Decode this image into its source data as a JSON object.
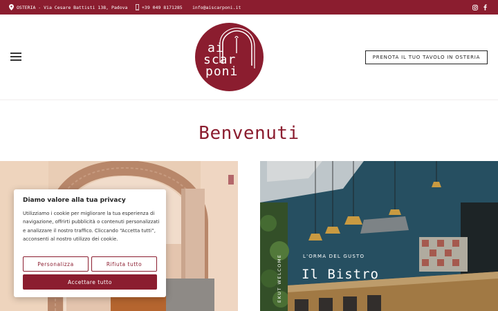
{
  "topbar": {
    "address": "OSTERIA - Via Cesare Battisti 138, Padova",
    "phone": "+39 049 8171285",
    "email": "info@aiscarponi.it",
    "icons": [
      "map-pin-icon",
      "phone-icon",
      "instagram-icon",
      "facebook-icon"
    ]
  },
  "header": {
    "logo_lines": [
      "ai",
      "scar",
      "poni"
    ],
    "cta_label": "PRENOTA IL TUO TAVOLO IN OSTERIA"
  },
  "main": {
    "welcome_title": "Benvenuti",
    "bistro": {
      "vertical_label": "EKUT WELCOME",
      "subtitle": "L'ORMA DEL GUSTO",
      "title": "Il Bistro"
    }
  },
  "cookie_banner": {
    "title": "Diamo valore alla tua privacy",
    "body": "Utilizziamo i cookie per migliorare la tua esperienza di navigazione, offrirti pubblicità o contenuti personalizzati e analizzare il nostro traffico. Cliccando “Accetta tutti”, acconsenti al nostro utilizzo dei cookie.",
    "customize_label": "Personalizza",
    "reject_label": "Rifiuta tutto",
    "accept_label": "Accettare tutto"
  },
  "colors": {
    "brand": "#8b1d2f",
    "text_dark": "#222222"
  }
}
